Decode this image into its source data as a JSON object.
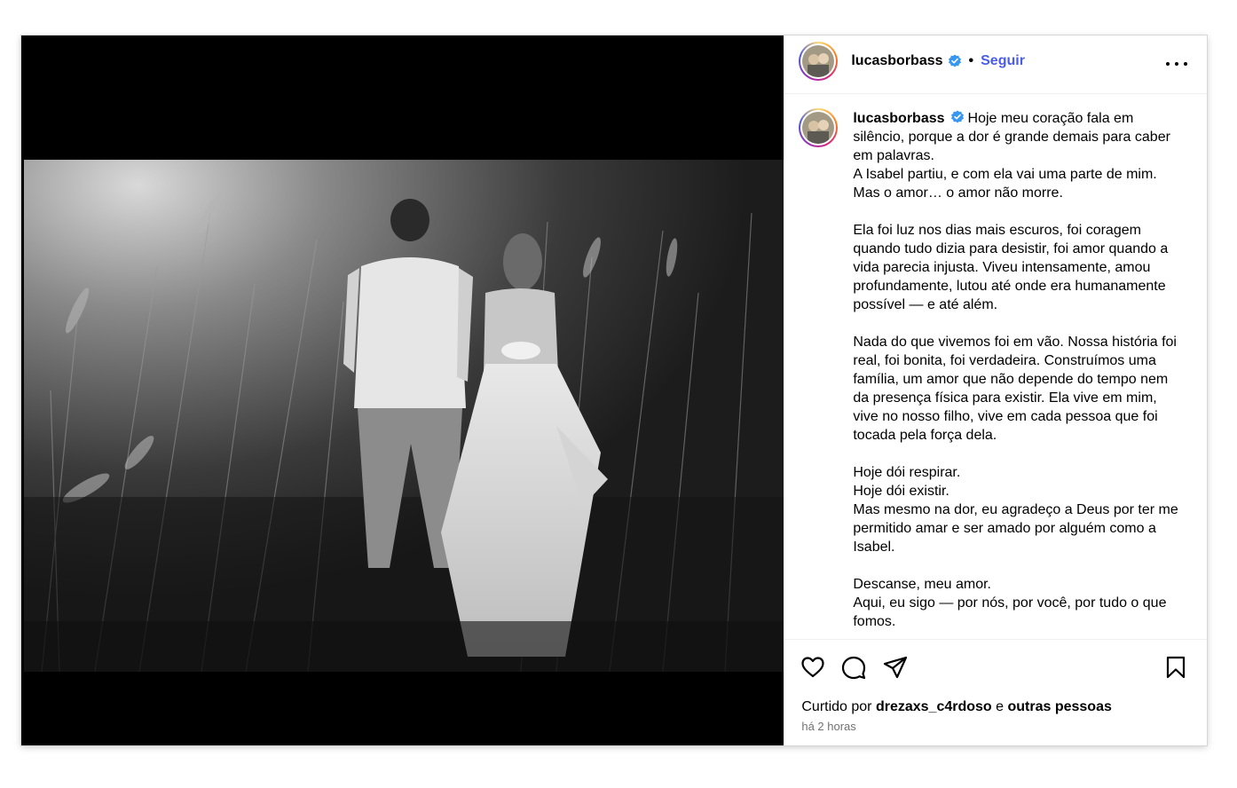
{
  "post": {
    "username": "lucasborbass",
    "follow_label": "Seguir",
    "separator": "•",
    "caption_text": "Hoje meu coração fala em silêncio, porque a dor é grande demais para caber em palavras.\nA Isabel partiu, e com ela vai uma parte de mim. Mas o amor… o amor não morre.\n\nEla foi luz nos dias mais escuros, foi coragem quando tudo dizia para desistir, foi amor quando a vida parecia injusta. Viveu intensamente, amou profundamente, lutou até onde era humanamente possível — e até além.\n\nNada do que vivemos foi em vão. Nossa história foi real, foi bonita, foi verdadeira. Construímos uma família, um amor que não depende do tempo nem da presença física para existir. Ela vive em mim, vive no nosso filho, vive em cada pessoa que foi tocada pela força dela.\n\nHoje dói respirar.\nHoje dói existir.\nMas mesmo na dor, eu agradeço a Deus por ter me permitido amar e ser amado por alguém como a Isabel.\n\nDescanse, meu amor.\nAqui, eu sigo — por nós, por você, por tudo o que fomos.",
    "likes_prefix": "Curtido por ",
    "liked_by_user": "drezaxs_c4rdoso",
    "likes_conjunction": " e ",
    "likes_others": "outras pessoas",
    "timestamp": "há 2 horas"
  },
  "icons": {
    "verified": "verified-badge-icon",
    "more": "more-options-icon",
    "like": "heart-icon",
    "comment": "comment-icon",
    "share": "share-icon",
    "save": "bookmark-icon"
  },
  "colors": {
    "accent": "#4a5de8",
    "verified": "#3897f0",
    "muted": "#737373"
  }
}
